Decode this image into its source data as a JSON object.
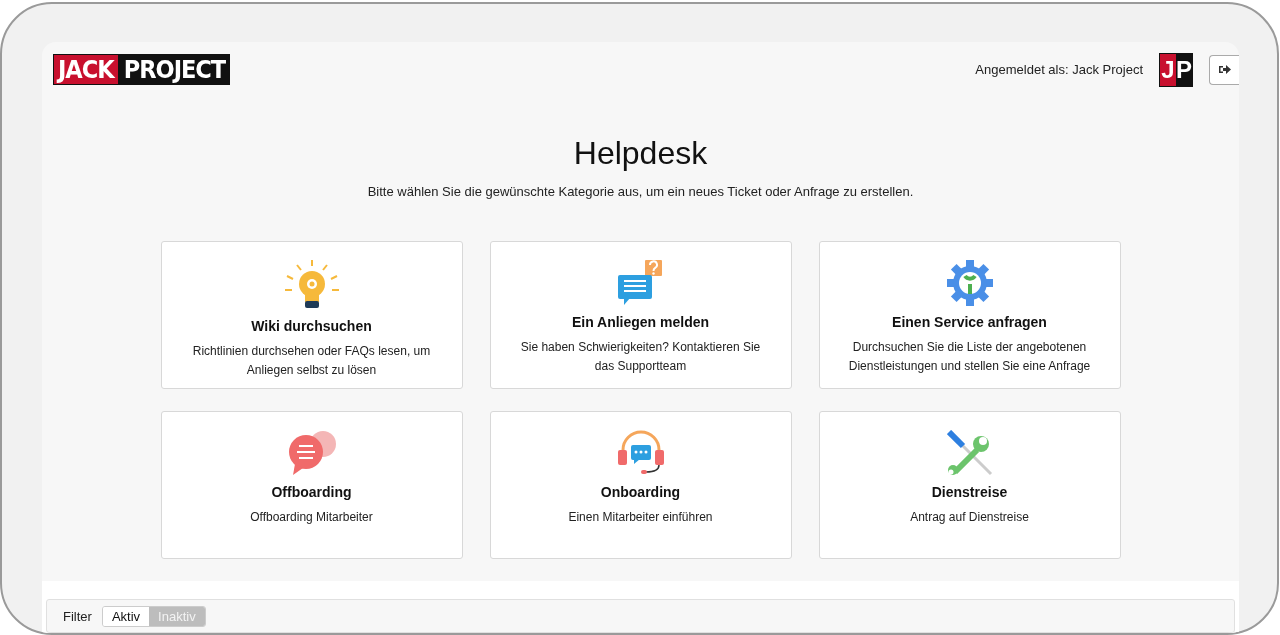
{
  "header": {
    "logo": {
      "part_1": "JACK",
      "part_2": "PROJECT"
    },
    "signed_in_label": "Angemeldet als: Jack Project",
    "avatar": {
      "letter_1": "J",
      "letter_2": "P"
    }
  },
  "hero": {
    "title": "Helpdesk",
    "subtitle": "Bitte wählen Sie die gewünschte Kategorie aus, um ein neues Ticket oder Anfrage zu erstellen."
  },
  "cards": [
    {
      "kind": "bulb",
      "title": "Wiki durchsuchen",
      "description": "Richtlinien durchsehen oder FAQs lesen, um Anliegen selbst zu lösen"
    },
    {
      "kind": "question-chat",
      "title": "Ein Anliegen melden",
      "description": "Sie haben Schwierigkeiten? Kontaktieren Sie das Supportteam"
    },
    {
      "kind": "gear",
      "title": "Einen Service anfragen",
      "description": "Durchsuchen Sie die Liste der angebotenen Dienstleistungen und stellen Sie eine Anfrage"
    },
    {
      "kind": "chat",
      "title": "Offboarding",
      "description": "Offboarding Mitarbeiter"
    },
    {
      "kind": "headset",
      "title": "Onboarding",
      "description": "Einen Mitarbeiter einführen"
    },
    {
      "kind": "tools",
      "title": "Dienstreise",
      "description": "Antrag auf Dienstreise"
    }
  ],
  "filter": {
    "label": "Filter",
    "options": [
      {
        "label": "Aktiv",
        "selected": true
      },
      {
        "label": "Inaktiv",
        "selected": false
      }
    ]
  }
}
